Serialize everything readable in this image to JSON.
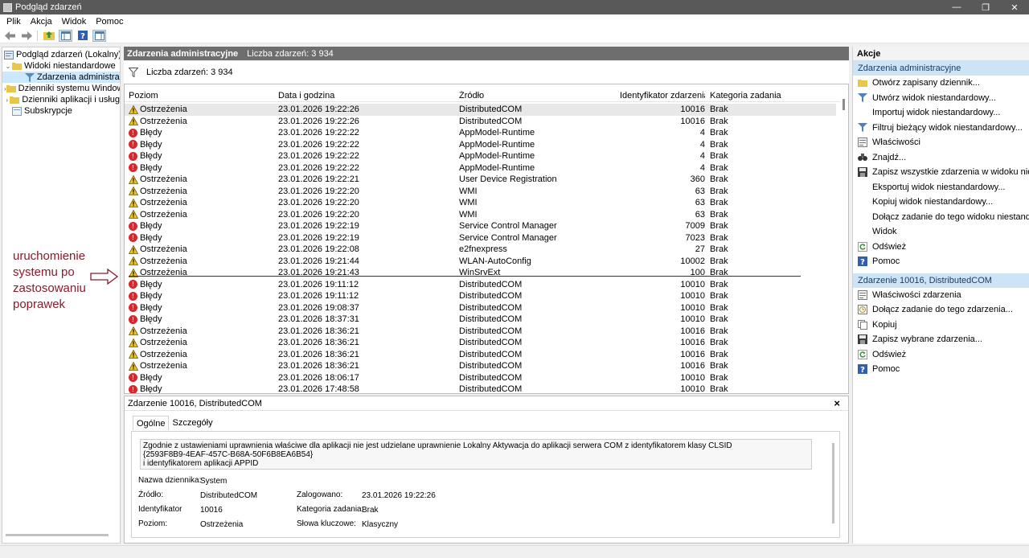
{
  "window": {
    "title": "Podgląd zdarzeń"
  },
  "menu": [
    "Plik",
    "Akcja",
    "Widok",
    "Pomoc"
  ],
  "tree": [
    {
      "label": "Podgląd zdarzeń (Lokalny)",
      "level": 0,
      "exp": ""
    },
    {
      "label": "Widoki niestandardowe",
      "level": 1,
      "exp": "v"
    },
    {
      "label": "Zdarzenia administracyjne",
      "level": 2,
      "exp": "",
      "selected": true
    },
    {
      "label": "Dzienniki systemu Windows",
      "level": 1,
      "exp": ">"
    },
    {
      "label": "Dzienniki aplikacji i usług",
      "level": 1,
      "exp": ">"
    },
    {
      "label": "Subskrypcje",
      "level": 1,
      "exp": ""
    }
  ],
  "center": {
    "title": "Zdarzenia administracyjne",
    "count_text": "Liczba zdarzeń: 3 934",
    "filter_text": "Liczba zdarzeń: 3 934"
  },
  "columns": [
    "Poziom",
    "Data i godzina",
    "Źródło",
    "Identyfikator zdarzenia",
    "Kategoria zadania"
  ],
  "rows": [
    {
      "level": "Ostrzeżenia",
      "type": "warn",
      "date": "23.01.2026 19:22:26",
      "source": "DistributedCOM",
      "id": "10016",
      "cat": "Brak",
      "selected": true
    },
    {
      "level": "Ostrzeżenia",
      "type": "warn",
      "date": "23.01.2026 19:22:26",
      "source": "DistributedCOM",
      "id": "10016",
      "cat": "Brak"
    },
    {
      "level": "Błędy",
      "type": "err",
      "date": "23.01.2026 19:22:22",
      "source": "AppModel-Runtime",
      "id": "4",
      "cat": "Brak"
    },
    {
      "level": "Błędy",
      "type": "err",
      "date": "23.01.2026 19:22:22",
      "source": "AppModel-Runtime",
      "id": "4",
      "cat": "Brak"
    },
    {
      "level": "Błędy",
      "type": "err",
      "date": "23.01.2026 19:22:22",
      "source": "AppModel-Runtime",
      "id": "4",
      "cat": "Brak"
    },
    {
      "level": "Błędy",
      "type": "err",
      "date": "23.01.2026 19:22:22",
      "source": "AppModel-Runtime",
      "id": "4",
      "cat": "Brak"
    },
    {
      "level": "Ostrzeżenia",
      "type": "warn",
      "date": "23.01.2026 19:22:21",
      "source": "User Device Registration",
      "id": "360",
      "cat": "Brak"
    },
    {
      "level": "Ostrzeżenia",
      "type": "warn",
      "date": "23.01.2026 19:22:20",
      "source": "WMI",
      "id": "63",
      "cat": "Brak"
    },
    {
      "level": "Ostrzeżenia",
      "type": "warn",
      "date": "23.01.2026 19:22:20",
      "source": "WMI",
      "id": "63",
      "cat": "Brak"
    },
    {
      "level": "Ostrzeżenia",
      "type": "warn",
      "date": "23.01.2026 19:22:20",
      "source": "WMI",
      "id": "63",
      "cat": "Brak"
    },
    {
      "level": "Błędy",
      "type": "err",
      "date": "23.01.2026 19:22:19",
      "source": "Service Control Manager",
      "id": "7009",
      "cat": "Brak"
    },
    {
      "level": "Błędy",
      "type": "err",
      "date": "23.01.2026 19:22:19",
      "source": "Service Control Manager",
      "id": "7023",
      "cat": "Brak"
    },
    {
      "level": "Ostrzeżenia",
      "type": "warn",
      "date": "23.01.2026 19:22:08",
      "source": "e2fnexpress",
      "id": "27",
      "cat": "Brak"
    },
    {
      "level": "Ostrzeżenia",
      "type": "warn",
      "date": "23.01.2026 19:21:44",
      "source": "WLAN-AutoConfig",
      "id": "10002",
      "cat": "Brak"
    },
    {
      "level": "Ostrzeżenia",
      "type": "warn",
      "date": "23.01.2026 19:21:43",
      "source": "WinSrvExt",
      "id": "100",
      "cat": "Brak"
    },
    {
      "level": "Błędy",
      "type": "err",
      "date": "23.01.2026 19:11:12",
      "source": "DistributedCOM",
      "id": "10010",
      "cat": "Brak"
    },
    {
      "level": "Błędy",
      "type": "err",
      "date": "23.01.2026 19:11:12",
      "source": "DistributedCOM",
      "id": "10010",
      "cat": "Brak"
    },
    {
      "level": "Błędy",
      "type": "err",
      "date": "23.01.2026 19:08:37",
      "source": "DistributedCOM",
      "id": "10010",
      "cat": "Brak"
    },
    {
      "level": "Błędy",
      "type": "err",
      "date": "23.01.2026 18:37:31",
      "source": "DistributedCOM",
      "id": "10010",
      "cat": "Brak"
    },
    {
      "level": "Ostrzeżenia",
      "type": "warn",
      "date": "23.01.2026 18:36:21",
      "source": "DistributedCOM",
      "id": "10016",
      "cat": "Brak"
    },
    {
      "level": "Ostrzeżenia",
      "type": "warn",
      "date": "23.01.2026 18:36:21",
      "source": "DistributedCOM",
      "id": "10016",
      "cat": "Brak"
    },
    {
      "level": "Ostrzeżenia",
      "type": "warn",
      "date": "23.01.2026 18:36:21",
      "source": "DistributedCOM",
      "id": "10016",
      "cat": "Brak"
    },
    {
      "level": "Ostrzeżenia",
      "type": "warn",
      "date": "23.01.2026 18:36:21",
      "source": "DistributedCOM",
      "id": "10016",
      "cat": "Brak"
    },
    {
      "level": "Błędy",
      "type": "err",
      "date": "23.01.2026 18:06:17",
      "source": "DistributedCOM",
      "id": "10010",
      "cat": "Brak"
    },
    {
      "level": "Błędy",
      "type": "err",
      "date": "23.01.2026 17:48:58",
      "source": "DistributedCOM",
      "id": "10010",
      "cat": "Brak"
    }
  ],
  "annotation": {
    "text": "uruchomienie systemu po zastosowaniu poprawek",
    "color": "#8b1a2b"
  },
  "detail": {
    "title": "Zdarzenie 10016, DistributedCOM",
    "close": "×",
    "tabs": [
      "Ogólne",
      "Szczegóły"
    ],
    "message": [
      "Zgodnie z ustawieniami uprawnienia właściwe dla aplikacji nie jest udzielane uprawnienie Lokalny Aktywacja do aplikacji serwera COM z identyfikatorem klasy CLSID",
      "{2593F8B9-4EAF-457C-B68A-50F6B8EA6B54}",
      " i identyfikatorem aplikacji APPID"
    ],
    "fields": {
      "log_name_label": "Nazwa dziennika:",
      "log_name": "System",
      "source_label": "Źródło:",
      "source": "DistributedCOM",
      "logged_label": "Zalogowano:",
      "logged": "23.01.2026 19:22:26",
      "id_label": "Identyfikator",
      "id": "10016",
      "category_label": "Kategoria zadania:",
      "category": "Brak",
      "level_label": "Poziom:",
      "level": "Ostrzeżenia",
      "keywords_label": "Słowa kluczowe:",
      "keywords": "Klasyczny"
    }
  },
  "actions": {
    "title": "Akcje",
    "section1": "Zdarzenia administracyjne",
    "items1": [
      {
        "label": "Otwórz zapisany dziennik...",
        "icon": "folder-icon"
      },
      {
        "label": "Utwórz widok niestandardowy...",
        "icon": "filter-icon"
      },
      {
        "label": "Importuj widok niestandardowy...",
        "icon": ""
      },
      {
        "label": "Filtruj bieżący widok niestandardowy...",
        "icon": "filter-icon"
      },
      {
        "label": "Właściwości",
        "icon": "properties-icon"
      },
      {
        "label": "Znajdź...",
        "icon": "binoculars-icon"
      },
      {
        "label": "Zapisz wszystkie zdarzenia w widoku niestandard...",
        "icon": "save-icon"
      },
      {
        "label": "Eksportuj widok niestandardowy...",
        "icon": ""
      },
      {
        "label": "Kopiuj widok niestandardowy...",
        "icon": ""
      },
      {
        "label": "Dołącz zadanie do tego widoku niestandardowe...",
        "icon": ""
      },
      {
        "label": "Widok",
        "icon": ""
      },
      {
        "label": "Odśwież",
        "icon": "refresh-icon"
      },
      {
        "label": "Pomoc",
        "icon": "help-icon"
      }
    ],
    "section2": "Zdarzenie 10016, DistributedCOM",
    "items2": [
      {
        "label": "Właściwości zdarzenia",
        "icon": "properties-icon"
      },
      {
        "label": "Dołącz zadanie do tego zdarzenia...",
        "icon": "task-icon"
      },
      {
        "label": "Kopiuj",
        "icon": "copy-icon"
      },
      {
        "label": "Zapisz wybrane zdarzenia...",
        "icon": "save-icon"
      },
      {
        "label": "Odśwież",
        "icon": "refresh-icon"
      },
      {
        "label": "Pomoc",
        "icon": "help-icon"
      }
    ]
  }
}
